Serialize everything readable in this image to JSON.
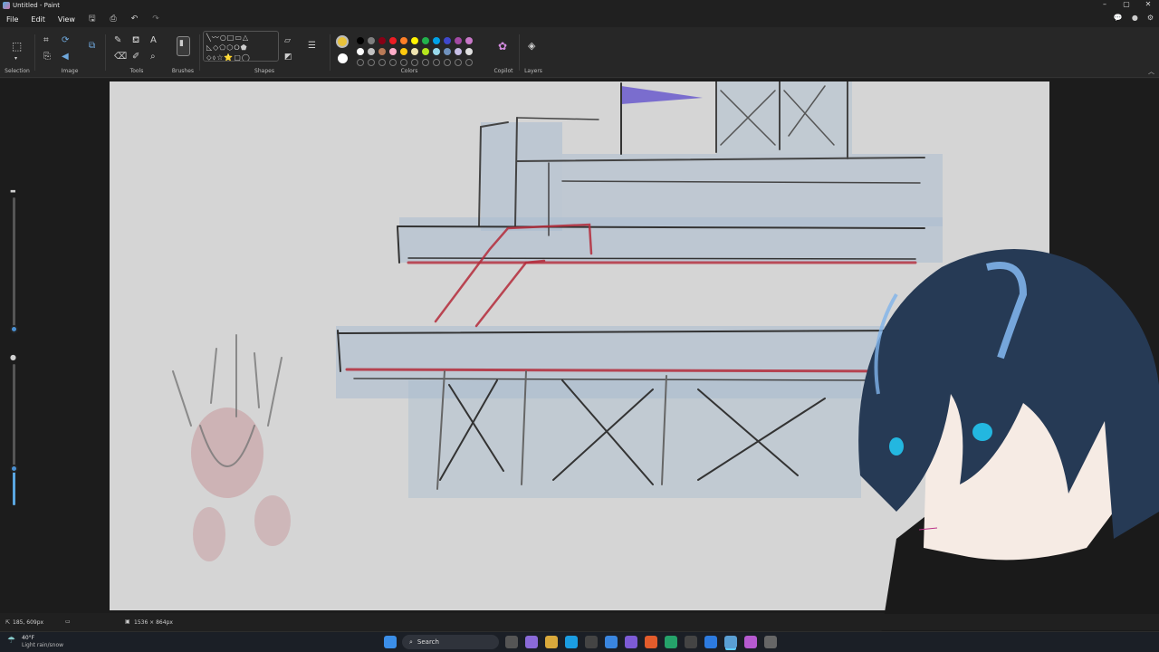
{
  "window": {
    "title": "Untitled - Paint",
    "controls": [
      "–",
      "▢",
      "✕"
    ]
  },
  "menu": {
    "file": "File",
    "edit": "Edit",
    "view": "View"
  },
  "ribbon": {
    "groups": {
      "selection": "Selection",
      "image": "Image",
      "tools": "Tools",
      "brushes": "Brushes",
      "shapes": "Shapes",
      "colors": "Colors",
      "copilot": "Copilot",
      "layers": "Layers"
    },
    "shapes_glyphs": [
      "╲〰○□▭△",
      "◺◇⬠⬡⭘⬟",
      "⬦⬨☆⭐▢◯"
    ],
    "palette_row1": [
      "#000000",
      "#7f7f7f",
      "#880015",
      "#ed1c24",
      "#ff7f27",
      "#fff200",
      "#22b14c",
      "#00a2e8",
      "#3f48cc",
      "#a349a4",
      "#c878c8"
    ],
    "palette_row2": [
      "#ffffff",
      "#c3c3c3",
      "#b97a57",
      "#ffaec9",
      "#ffc90e",
      "#efe4b0",
      "#b5e61d",
      "#99d9ea",
      "#7092be",
      "#c8bfe7",
      "#e0e0e0"
    ],
    "primary_color": "#e8c23a",
    "secondary_color": "#ffffff"
  },
  "status": {
    "cursor_pos": "185, 609px",
    "canvas_size": "1536 × 864px"
  },
  "taskbar": {
    "weather_temp": "40°F",
    "weather_desc": "Light rain/snow",
    "search_placeholder": "Search"
  },
  "colors": {
    "canvas_bg": "#d5d5d5",
    "accent": "#4a8fd0",
    "ink_red": "#b42a3a",
    "ink_blue": "#9fb6cf"
  }
}
